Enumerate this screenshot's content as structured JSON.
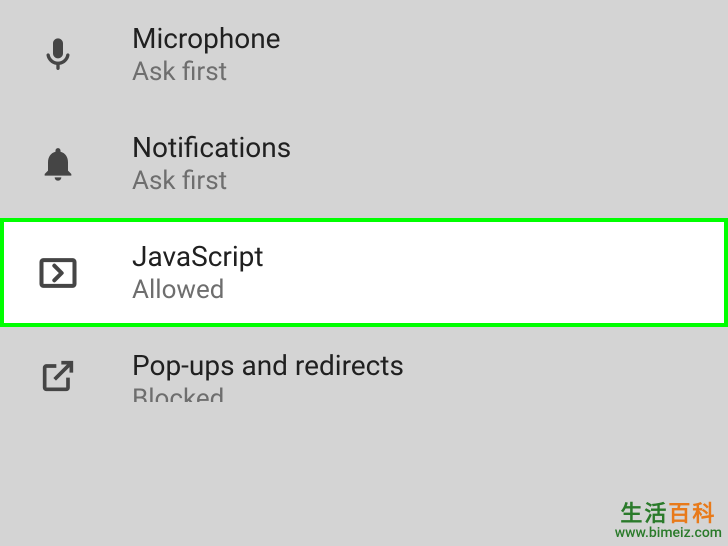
{
  "settings": {
    "items": [
      {
        "title": "Microphone",
        "subtitle": "Ask first"
      },
      {
        "title": "Notifications",
        "subtitle": "Ask first"
      },
      {
        "title": "JavaScript",
        "subtitle": "Allowed"
      },
      {
        "title": "Pop-ups and redirects",
        "subtitle": "Blocked"
      }
    ]
  },
  "watermark": {
    "logo_left": "生活",
    "logo_right": "百科",
    "url": "www.bimeiz.com"
  }
}
